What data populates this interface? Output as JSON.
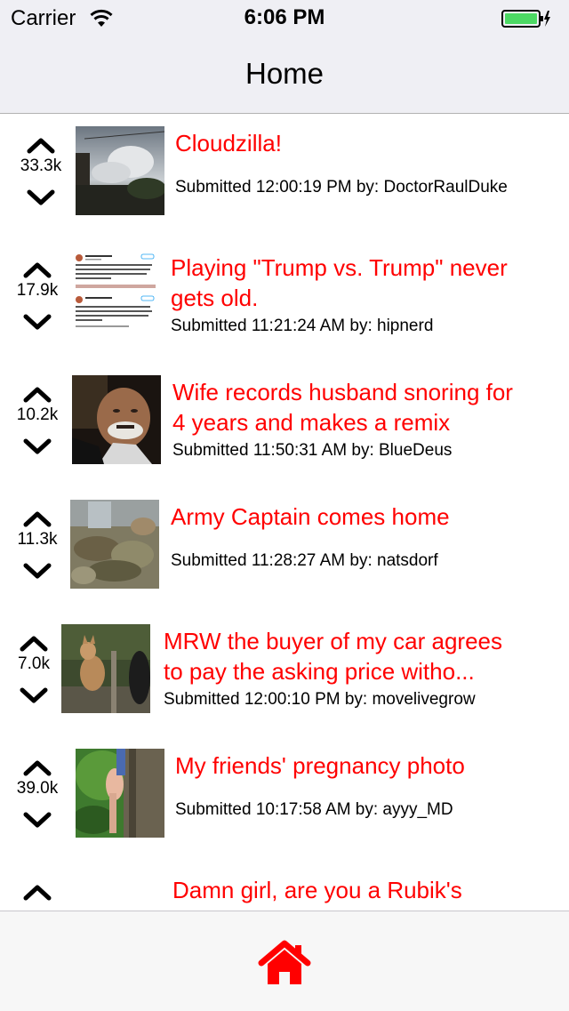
{
  "status_bar": {
    "carrier": "Carrier",
    "time": "6:06 PM"
  },
  "nav": {
    "title": "Home"
  },
  "posts": [
    {
      "score": "33.3k",
      "title1": "Cloudzilla!",
      "title2": "",
      "meta": "Submitted 12:00:19 PM by: DoctorRaulDuke"
    },
    {
      "score": "17.9k",
      "title1": "Playing \"Trump vs. Trump\" never",
      "title2": "gets old.",
      "meta": "Submitted 11:21:24 AM by: hipnerd"
    },
    {
      "score": "10.2k",
      "title1": "Wife records husband snoring for",
      "title2": "4 years and makes a remix",
      "meta": "Submitted 11:50:31 AM by: BlueDeus"
    },
    {
      "score": "11.3k",
      "title1": "Army Captain comes home",
      "title2": "",
      "meta": "Submitted 11:28:27 AM by: natsdorf"
    },
    {
      "score": "7.0k",
      "title1": "MRW the buyer of my car agrees",
      "title2": "to pay the asking price witho...",
      "meta": "Submitted 12:00:10 PM by: movelivegrow"
    },
    {
      "score": "39.0k",
      "title1": "My friends' pregnancy photo",
      "title2": "",
      "meta": "Submitted 10:17:58 AM by: ayyy_MD"
    },
    {
      "score": "",
      "title1": "Damn girl, are you a Rubik's",
      "title2": "",
      "meta": ""
    }
  ],
  "colors": {
    "accent": "#ff0000",
    "nav_bg": "#efeff4",
    "battery": "#4cd964"
  },
  "icons": {
    "upvote": "chevron-up-icon",
    "downvote": "chevron-down-icon",
    "tab_home": "home-icon"
  }
}
